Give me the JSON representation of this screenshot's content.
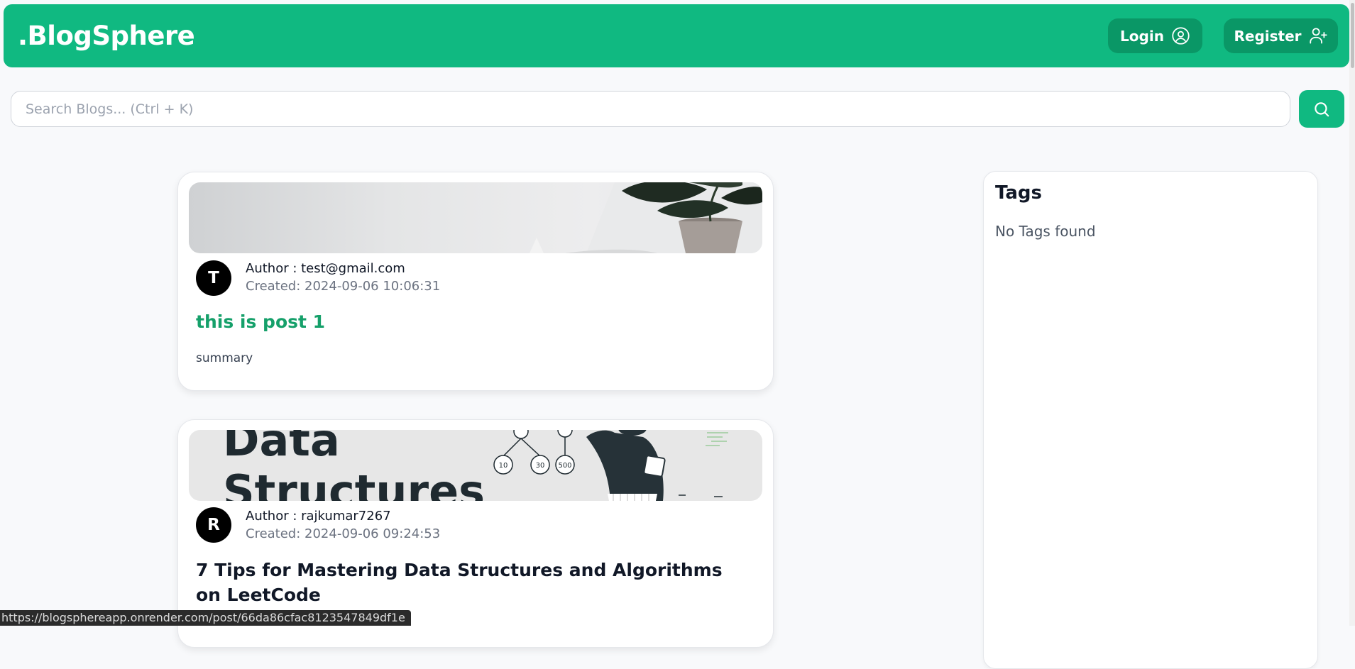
{
  "header": {
    "brand": ".BlogSphere",
    "login_label": "Login",
    "register_label": "Register"
  },
  "search": {
    "placeholder": "Search Blogs... (Ctrl + K)"
  },
  "posts": [
    {
      "avatar_letter": "T",
      "author": "Author : test@gmail.com",
      "created": "Created: 2024-09-06 10:06:31",
      "title": "this is post 1",
      "summary": "summary"
    },
    {
      "avatar_letter": "R",
      "author": "Author : rajkumar7267",
      "created": "Created: 2024-09-06 09:24:53",
      "title": "7 Tips for Mastering Data Structures and Algorithms on LeetCode",
      "cover_text": [
        "Data",
        "Structures"
      ],
      "cover_nodes": [
        "10",
        "30",
        "500"
      ]
    }
  ],
  "tags": {
    "title": "Tags",
    "empty_message": "No Tags found"
  },
  "status_bar": {
    "url": "https://blogsphereapp.onrender.com/post/66da86cfac8123547849df1e"
  },
  "colors": {
    "accent": "#10b981",
    "accent_dark": "#0a9766",
    "title_green": "#15a06a"
  },
  "icons": {
    "login": "user-circle-icon",
    "register": "user-plus-icon",
    "search": "search-icon"
  }
}
